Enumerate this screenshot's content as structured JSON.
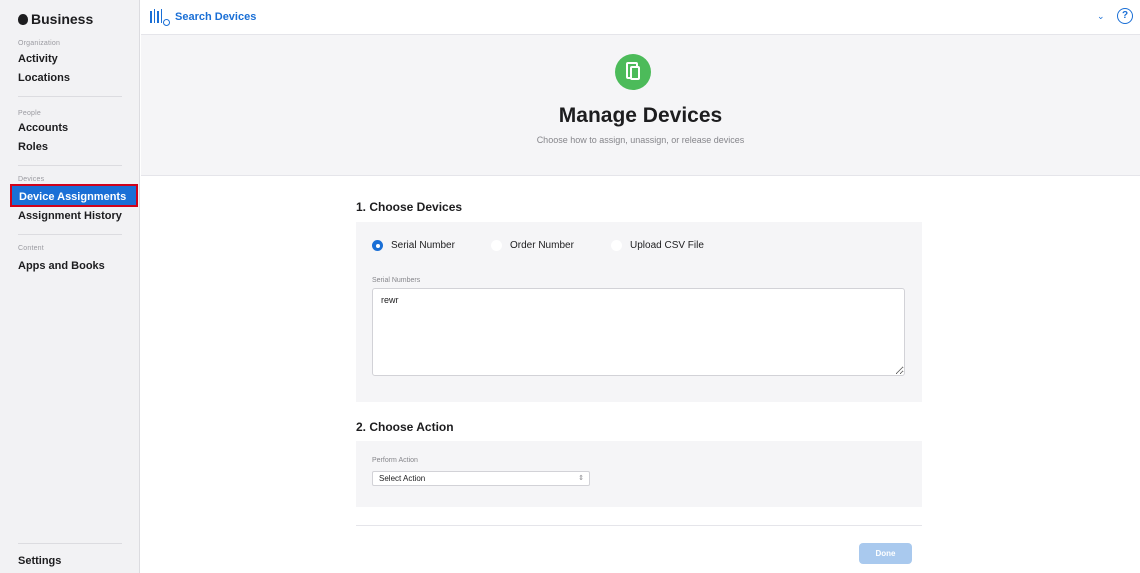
{
  "sidebar": {
    "brand": "Business",
    "sections": {
      "organization": "Organization",
      "people": "People",
      "devices": "Devices",
      "content": "Content"
    },
    "items": {
      "activity": "Activity",
      "locations": "Locations",
      "accounts": "Accounts",
      "roles": "Roles",
      "device_assignments": "Device Assignments",
      "assignment_history": "Assignment History",
      "apps_and_books": "Apps and Books",
      "settings": "Settings"
    }
  },
  "topbar": {
    "search_label": "Search Devices",
    "help": "?"
  },
  "header": {
    "title": "Manage Devices",
    "subtitle": "Choose how to assign, unassign, or release devices"
  },
  "step1": {
    "title": "1. Choose Devices",
    "options": [
      "Serial Number",
      "Order Number",
      "Upload CSV File"
    ],
    "selected": "Serial Number",
    "field_label": "Serial Numbers",
    "field_value": "rewr"
  },
  "step2": {
    "title": "2. Choose Action",
    "field_label": "Perform Action",
    "select_value": "Select Action"
  },
  "done_label": "Done",
  "colors": {
    "accent": "#1a6fd6",
    "highlight_border": "#d0021b",
    "hero_icon": "#4cbb5a"
  }
}
